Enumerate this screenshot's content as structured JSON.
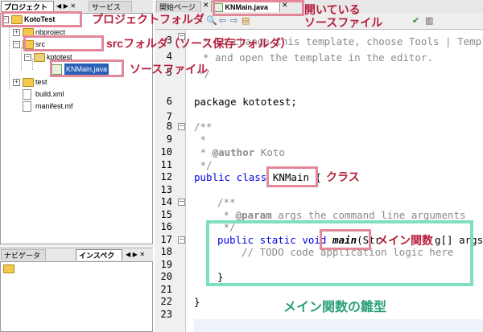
{
  "projects_panel": {
    "tabs": [
      {
        "label": "プロジェクト",
        "active": true
      },
      {
        "label": "サービス",
        "active": false
      }
    ],
    "tree": [
      {
        "label": "KotoTest",
        "icon": "folder-icon",
        "depth": 0
      },
      {
        "label": "nbproject",
        "icon": "folder-icon",
        "depth": 1
      },
      {
        "label": "src",
        "icon": "folder-icon",
        "depth": 1
      },
      {
        "label": "kototest",
        "icon": "folder-icon",
        "depth": 2
      },
      {
        "label": "KNMain.java",
        "icon": "java-file-icon",
        "depth": 3,
        "selected": true
      },
      {
        "label": "test",
        "icon": "folder-icon",
        "depth": 1
      },
      {
        "label": "build.xml",
        "icon": "file-icon",
        "depth": 1
      },
      {
        "label": "manifest.mf",
        "icon": "file-icon",
        "depth": 1
      }
    ]
  },
  "navigator_panel": {
    "tabs": [
      {
        "label": "ナビゲータ",
        "active": false
      },
      {
        "label": "インスペクタ",
        "active": true
      }
    ]
  },
  "editor": {
    "tabs": [
      {
        "label": "開始ページ",
        "active": false
      },
      {
        "label": "KNMain.java",
        "active": true
      }
    ],
    "line_numbers": [
      "3",
      "4",
      "5",
      "6",
      "7",
      "8",
      "9",
      "10",
      "11",
      "12",
      "13",
      "14",
      "15",
      "16",
      "17",
      "18",
      "19",
      "20",
      "21",
      "22",
      "23"
    ],
    "lines": {
      "l3": "* To change this template, choose Tools | Templa",
      "l4": "* and open the template in the editor.",
      "l5": "*/",
      "l6": "package kototest;",
      "l8": "/**",
      "l9": " *",
      "l10_tag": "@author",
      "l10_rest": " Koto",
      "l11": " */",
      "l12_kw": "public class ",
      "l12_name": "KNMain",
      "l12_brace": " {",
      "l14": "/**",
      "l15_tag": "@param",
      "l15_rest": " args the command line arguments",
      "l16": " */",
      "l17_kw": "public static void ",
      "l17_name": "main",
      "l17_rest": "(Str",
      "l17_tail": "g[] args) {",
      "l18": "// TODO code application logic here",
      "l20": "}",
      "l22": "}"
    }
  },
  "callouts": {
    "project_folder": "プロジェクトフォルダ",
    "open_source": "開いている\nソースファイル",
    "src_folder": "srcフォルダ（ソース保存フォルダ）",
    "source_file": "ソースファイル",
    "class": "クラス",
    "main_func": "メイン関数",
    "main_template": "メイン関数の雛型"
  },
  "colors": {
    "callout_text": "#b51e3a",
    "pink_box": "#e3889a",
    "green_box": "#7fe0bd",
    "keyword": "#0000e6",
    "comment": "#8a8a8a"
  }
}
